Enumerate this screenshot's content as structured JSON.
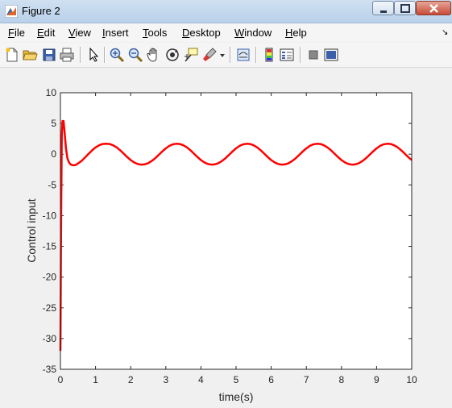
{
  "window": {
    "title": "Figure 2"
  },
  "menu": {
    "items": [
      {
        "label": "File",
        "key": "F",
        "rest": "ile"
      },
      {
        "label": "Edit",
        "key": "E",
        "rest": "dit"
      },
      {
        "label": "View",
        "key": "V",
        "rest": "iew"
      },
      {
        "label": "Insert",
        "key": "I",
        "rest": "nsert"
      },
      {
        "label": "Tools",
        "key": "T",
        "rest": "ools"
      },
      {
        "label": "Desktop",
        "key": "D",
        "rest": "esktop"
      },
      {
        "label": "Window",
        "key": "W",
        "rest": "indow"
      },
      {
        "label": "Help",
        "key": "H",
        "rest": "elp"
      }
    ]
  },
  "toolbar": {
    "icons": [
      "new-figure-icon",
      "open-file-icon",
      "save-icon",
      "print-icon",
      "edit-plot-arrow-icon",
      "zoom-in-icon",
      "zoom-out-icon",
      "pan-hand-icon",
      "rotate-3d-icon",
      "data-cursor-icon",
      "brush-icon",
      "link-plot-icon",
      "insert-colorbar-icon",
      "insert-legend-icon",
      "hide-plot-tools-icon",
      "show-plot-tools-icon"
    ]
  },
  "chart_data": {
    "type": "line",
    "xlabel": "time(s)",
    "ylabel": "Control input",
    "title": "",
    "xlim": [
      0,
      10
    ],
    "ylim": [
      -35,
      10
    ],
    "xticks": [
      "0",
      "1",
      "2",
      "3",
      "4",
      "5",
      "6",
      "7",
      "8",
      "9",
      "10"
    ],
    "yticks": [
      "10",
      "5",
      "0",
      "-5",
      "-10",
      "-15",
      "-20",
      "-25",
      "-30",
      "-35"
    ],
    "grid": false,
    "series": [
      {
        "color": "#ff0000",
        "x": [
          0,
          0.02,
          0.04,
          0.06,
          0.09,
          0.12,
          0.16,
          0.2,
          0.25,
          0.3,
          0.35,
          0.4,
          0.45,
          0.5,
          0.6,
          0.7,
          0.8,
          0.9,
          1.0,
          1.1,
          1.2,
          1.3,
          1.4,
          1.5,
          1.6,
          1.7,
          1.8,
          1.9,
          2.0,
          2.1,
          2.2,
          2.3,
          2.4,
          2.5,
          2.6,
          2.7,
          2.8,
          2.9,
          3.0,
          3.1,
          3.2,
          3.3,
          3.4,
          3.5,
          3.6,
          3.7,
          3.8,
          3.9,
          4.0,
          4.1,
          4.2,
          4.3,
          4.4,
          4.5,
          4.6,
          4.7,
          4.8,
          4.9,
          5.0,
          5.1,
          5.2,
          5.3,
          5.4,
          5.5,
          5.6,
          5.7,
          5.8,
          5.9,
          6.0,
          6.1,
          6.2,
          6.3,
          6.4,
          6.5,
          6.6,
          6.7,
          6.8,
          6.9,
          7.0,
          7.1,
          7.2,
          7.3,
          7.4,
          7.5,
          7.6,
          7.7,
          7.8,
          7.9,
          8.0,
          8.1,
          8.2,
          8.3,
          8.4,
          8.5,
          8.6,
          8.7,
          8.8,
          8.9,
          9.0,
          9.1,
          9.2,
          9.3,
          9.4,
          9.5,
          9.6,
          9.7,
          9.8,
          9.9,
          10.0
        ],
        "y": [
          -32,
          -10,
          3,
          5.4,
          5.4,
          3.5,
          0.8,
          -0.7,
          -1.4,
          -1.7,
          -1.8,
          -1.8,
          -1.7,
          -1.5,
          -1.1,
          -0.55,
          0.05,
          0.6,
          1.1,
          1.45,
          1.65,
          1.7,
          1.65,
          1.45,
          1.1,
          0.65,
          0.1,
          -0.45,
          -0.95,
          -1.35,
          -1.6,
          -1.7,
          -1.65,
          -1.45,
          -1.1,
          -0.65,
          -0.1,
          0.45,
          0.95,
          1.35,
          1.6,
          1.7,
          1.65,
          1.45,
          1.1,
          0.65,
          0.1,
          -0.45,
          -0.95,
          -1.35,
          -1.6,
          -1.7,
          -1.65,
          -1.45,
          -1.1,
          -0.65,
          -0.1,
          0.45,
          0.95,
          1.35,
          1.6,
          1.7,
          1.65,
          1.45,
          1.1,
          0.65,
          0.1,
          -0.45,
          -0.95,
          -1.35,
          -1.6,
          -1.7,
          -1.65,
          -1.45,
          -1.1,
          -0.65,
          -0.1,
          0.45,
          0.95,
          1.35,
          1.6,
          1.7,
          1.65,
          1.45,
          1.1,
          0.65,
          0.1,
          -0.45,
          -0.95,
          -1.35,
          -1.6,
          -1.7,
          -1.65,
          -1.45,
          -1.1,
          -0.65,
          -0.1,
          0.45,
          0.95,
          1.35,
          1.6,
          1.7,
          1.65,
          1.45,
          1.1,
          0.65,
          0.1,
          -0.45,
          -0.95
        ]
      }
    ]
  }
}
